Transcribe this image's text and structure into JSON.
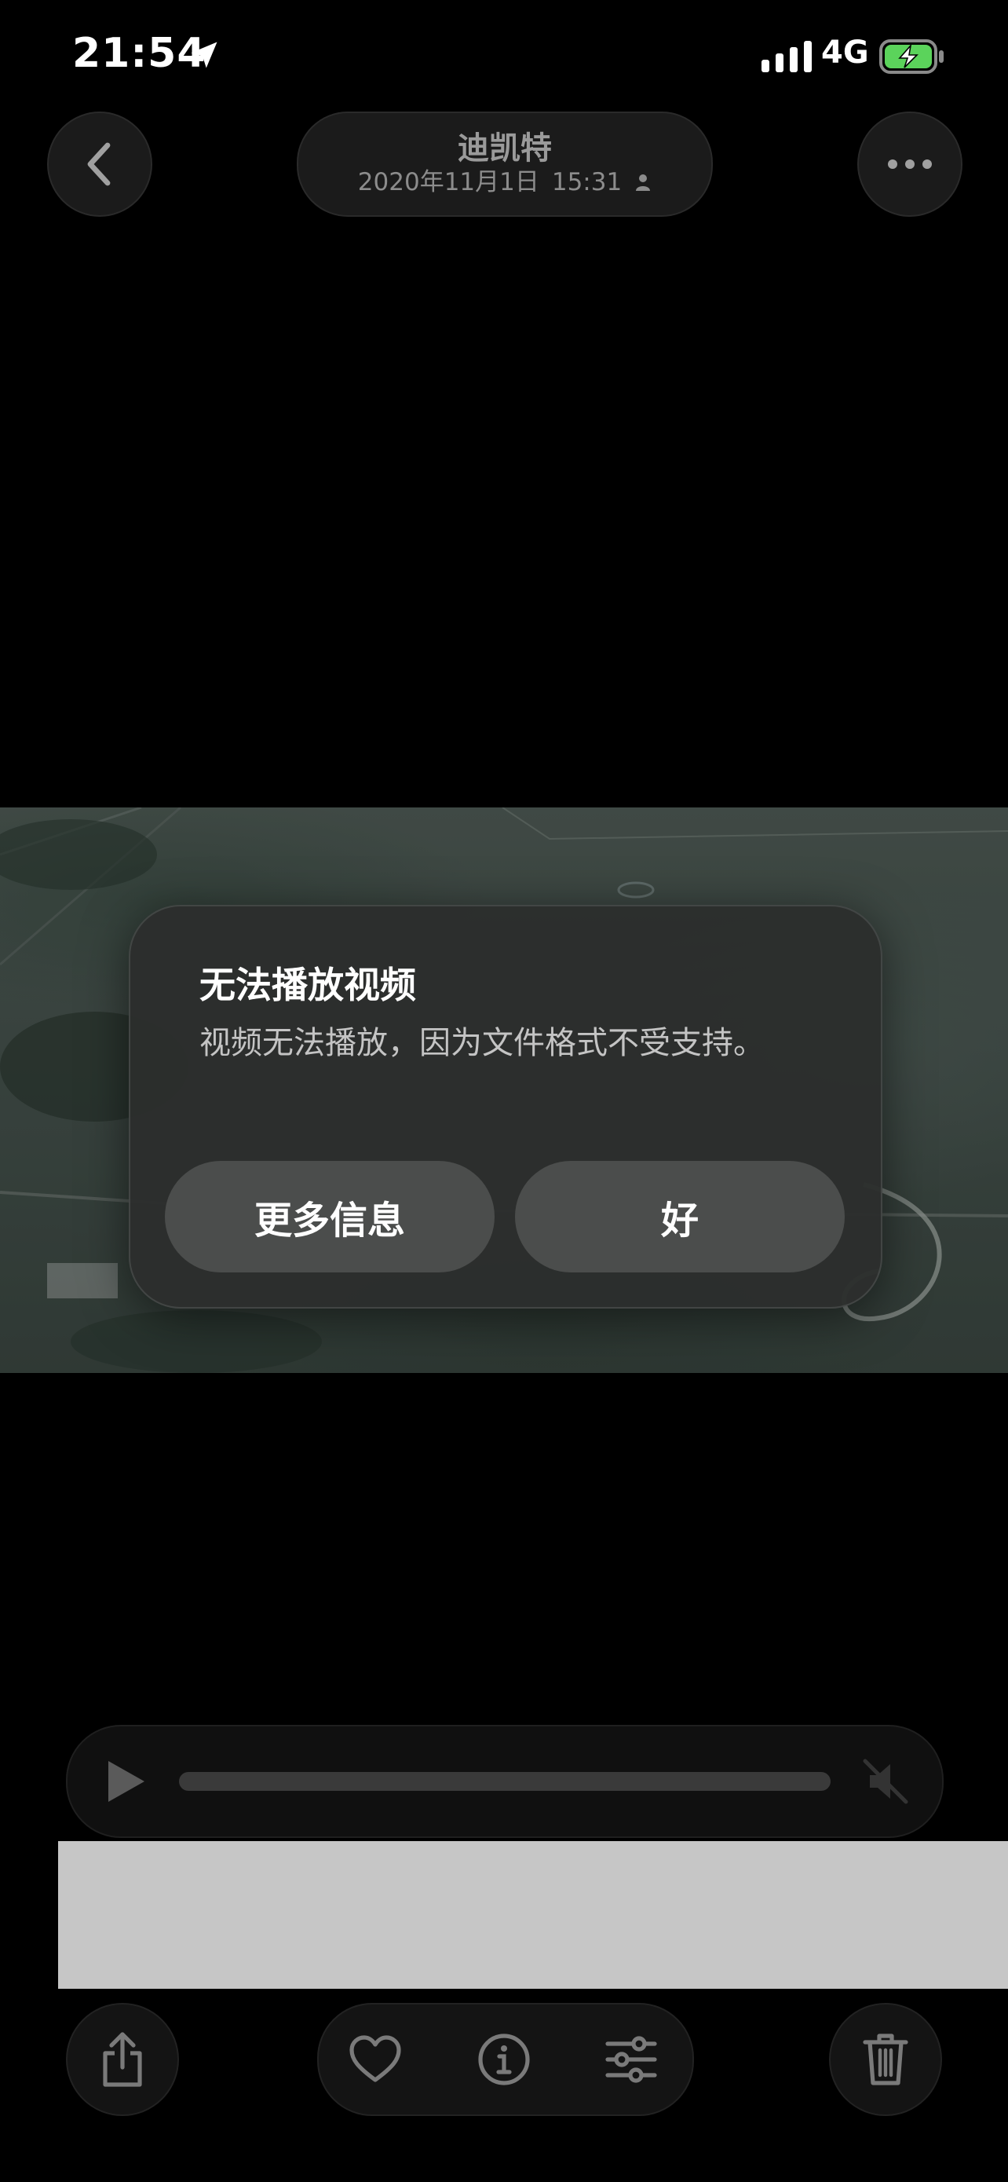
{
  "status_bar": {
    "time": "21:54",
    "network": "4G",
    "icons": [
      "location-arrow-icon",
      "signal-icon",
      "battery-charging-icon"
    ],
    "battery_color": "#5bd35b"
  },
  "nav": {
    "title": "迪凯特",
    "date": "2020年11月1日",
    "time": "15:31",
    "icons": [
      "chevron-left-icon",
      "person-icon",
      "ellipsis-icon"
    ]
  },
  "alert": {
    "title": "无法播放视频",
    "message": "视频无法播放，因为文件格式不受支持。",
    "more_info_label": "更多信息",
    "ok_label": "好"
  },
  "player": {
    "icons": [
      "play-icon",
      "speaker-muted-icon"
    ]
  },
  "toolbar": {
    "icons": [
      "share-icon",
      "heart-icon",
      "info-icon",
      "adjust-icon",
      "trash-icon"
    ]
  }
}
